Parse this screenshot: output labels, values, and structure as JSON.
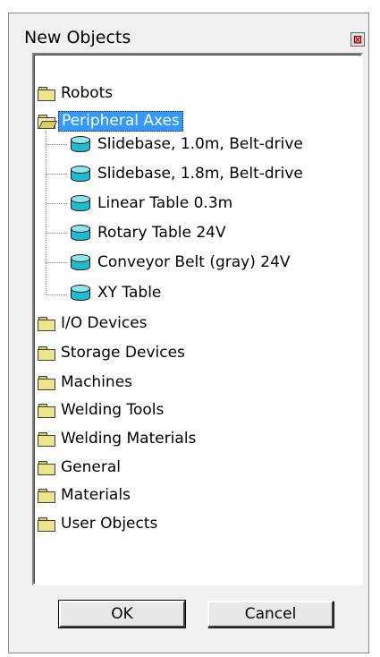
{
  "window": {
    "title": "New Objects",
    "close_glyph": "⊠"
  },
  "tree": {
    "folders_top": [
      {
        "label": "Robots",
        "icon": "folder-closed-icon",
        "selected": false
      }
    ],
    "expanded_folder": {
      "label": "Peripheral Axes",
      "icon": "folder-open-icon",
      "selected": true
    },
    "children": [
      {
        "label": "Slidebase, 1.0m, Belt-drive",
        "icon": "cylinder-object-icon"
      },
      {
        "label": "Slidebase, 1.8m, Belt-drive",
        "icon": "cylinder-object-icon"
      },
      {
        "label": "Linear Table 0.3m",
        "icon": "cylinder-object-icon"
      },
      {
        "label": "Rotary Table 24V",
        "icon": "cylinder-object-icon"
      },
      {
        "label": "Conveyor Belt (gray) 24V",
        "icon": "cylinder-object-icon"
      },
      {
        "label": "XY Table",
        "icon": "cylinder-object-icon"
      }
    ],
    "folders_bottom": [
      {
        "label": "I/O Devices"
      },
      {
        "label": "Storage Devices"
      },
      {
        "label": "Machines"
      },
      {
        "label": "Welding Tools"
      },
      {
        "label": "Welding Materials"
      },
      {
        "label": "General"
      },
      {
        "label": "Materials"
      },
      {
        "label": "User Objects"
      }
    ]
  },
  "buttons": {
    "ok_label": "OK",
    "cancel_label": "Cancel"
  },
  "colors": {
    "selection": "#3399ff",
    "dialog_bg": "#f0f0f0",
    "folder": "#ece48a",
    "object_icon": "#1fbcd1"
  }
}
